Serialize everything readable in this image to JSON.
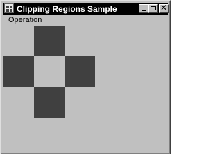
{
  "window": {
    "title": "Clipping Regions Sample",
    "icon": "app-window-icon",
    "caption_buttons": [
      {
        "name": "minimize",
        "icon": "minimize-icon"
      },
      {
        "name": "maximize",
        "icon": "maximize-icon"
      },
      {
        "name": "close",
        "icon": "close-icon",
        "glyph": "✕"
      }
    ]
  },
  "menu": {
    "items": [
      {
        "label": "Operation"
      }
    ]
  },
  "canvas": {
    "fill_color": "#404040",
    "background_color": "#c0c0c0",
    "shapes": [
      "top",
      "left",
      "right",
      "bottom"
    ]
  }
}
